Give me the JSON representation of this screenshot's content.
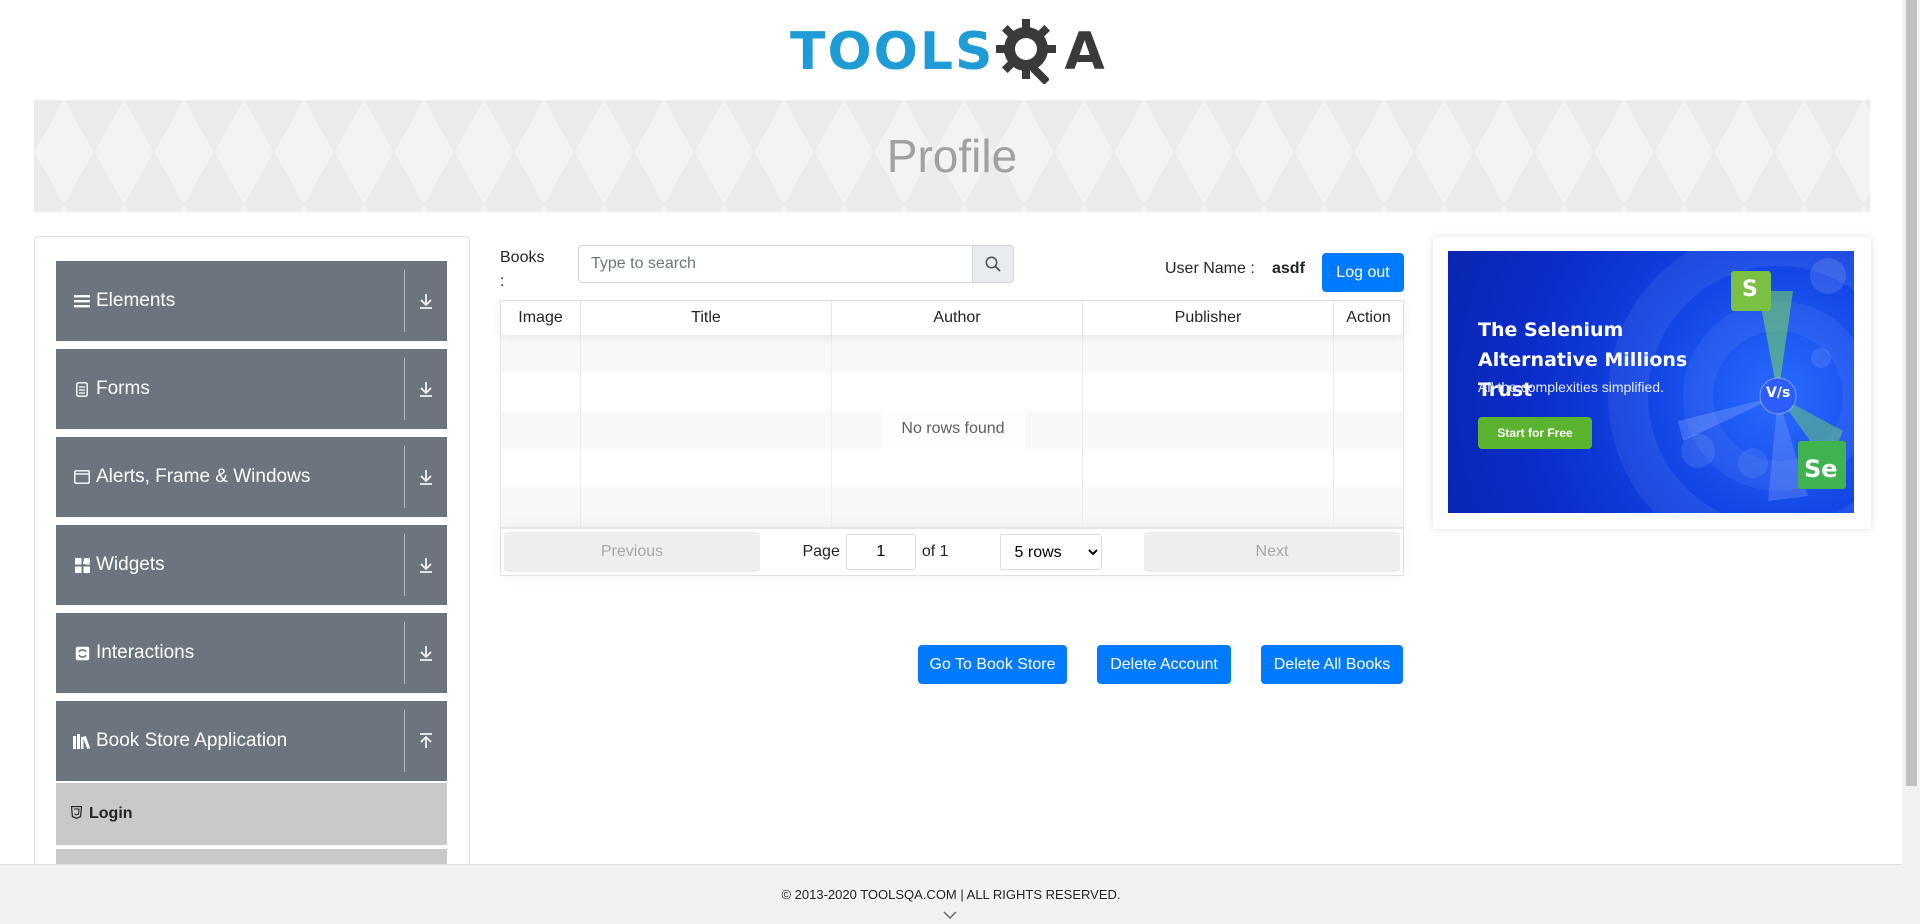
{
  "header": {
    "logo_text_left": "TOOLS",
    "logo_text_right": "A",
    "banner_title": "Profile"
  },
  "sidebar": {
    "groups": [
      {
        "label": "Elements",
        "icon": "hamburger-icon",
        "arrow": "download-arrow-icon"
      },
      {
        "label": "Forms",
        "icon": "form-icon",
        "arrow": "download-arrow-icon"
      },
      {
        "label": "Alerts, Frame & Windows",
        "icon": "window-icon",
        "arrow": "download-arrow-icon"
      },
      {
        "label": "Widgets",
        "icon": "widgets-icon",
        "arrow": "download-arrow-icon"
      },
      {
        "label": "Interactions",
        "icon": "interaction-icon",
        "arrow": "download-arrow-icon"
      },
      {
        "label": "Book Store Application",
        "icon": "books-icon",
        "arrow": "upload-arrow-icon"
      }
    ],
    "items": [
      {
        "label": "Login",
        "icon": "html5-icon"
      }
    ]
  },
  "books": {
    "label": "Books :",
    "search_placeholder": "Type to search",
    "search_value": ""
  },
  "user": {
    "label": "User Name :",
    "value": "asdf",
    "logout_label": "Log out"
  },
  "table": {
    "columns": [
      "Image",
      "Title",
      "Author",
      "Publisher",
      "Action"
    ],
    "empty_text": "No rows found",
    "pagination": {
      "previous_label": "Previous",
      "next_label": "Next",
      "page_label": "Page",
      "current_page": "1",
      "of_label": "of 1",
      "rows_selected": "5 rows"
    }
  },
  "actions": {
    "go_to_store": "Go To Book Store",
    "delete_account": "Delete Account",
    "delete_all_books": "Delete All Books"
  },
  "ad": {
    "title": "The Selenium Alternative Millions Trust",
    "subtitle": "All the complexities simplified.",
    "cta": "Start for Free",
    "badge_se": "Se",
    "badge_s": "S",
    "badge_vs": "V/s",
    "colors": {
      "background": "#0b2cc8",
      "cta": "#5cb32f",
      "badge_green": "#3fb34f"
    }
  },
  "footer": {
    "text": "© 2013-2020 TOOLSQA.COM | ALL RIGHTS RESERVED."
  },
  "colors": {
    "primary_button": "#007bff",
    "sidebar_group": "#6c757d",
    "sidebar_item_active": "#c9c9c9",
    "logo_blue": "#1f9bd6",
    "logo_dark": "#3a3a3a"
  }
}
